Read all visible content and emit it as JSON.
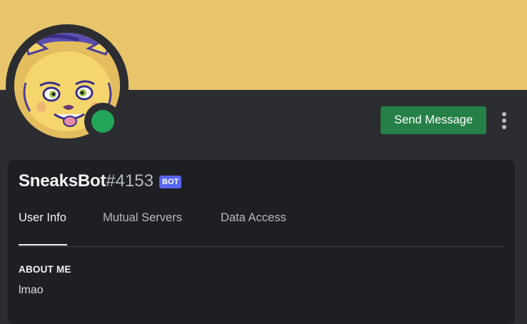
{
  "profile": {
    "username": "SneaksBot",
    "discriminator": "#4153",
    "bot_tag": "BOT",
    "status": "online",
    "banner_color": "#e8c46b",
    "status_color": "#23a55a"
  },
  "actions": {
    "send_message_label": "Send Message",
    "more_icon": "more-vertical-icon"
  },
  "tabs": [
    {
      "label": "User Info",
      "active": true
    },
    {
      "label": "Mutual Servers",
      "active": false
    },
    {
      "label": "Data Access",
      "active": false
    }
  ],
  "about": {
    "heading": "ABOUT ME",
    "text": "lmao"
  }
}
